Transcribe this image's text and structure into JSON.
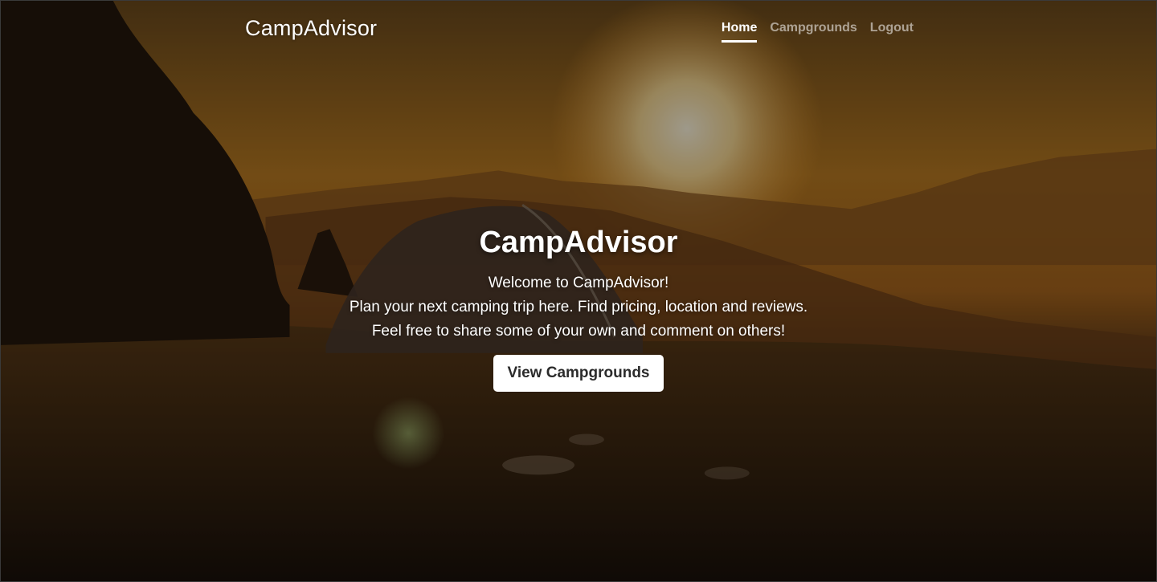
{
  "brand": "CampAdvisor",
  "nav": {
    "home": "Home",
    "campgrounds": "Campgrounds",
    "logout": "Logout"
  },
  "hero": {
    "title": "CampAdvisor",
    "lines": [
      "Welcome to CampAdvisor!",
      "Plan your next camping trip here. Find pricing, location and reviews.",
      "Feel free to share some of your own and comment on others!"
    ],
    "button_label": "View Campgrounds"
  },
  "colors": {
    "text": "#ffffff",
    "button_bg": "#ffffff",
    "button_text": "#2b2b2b"
  }
}
